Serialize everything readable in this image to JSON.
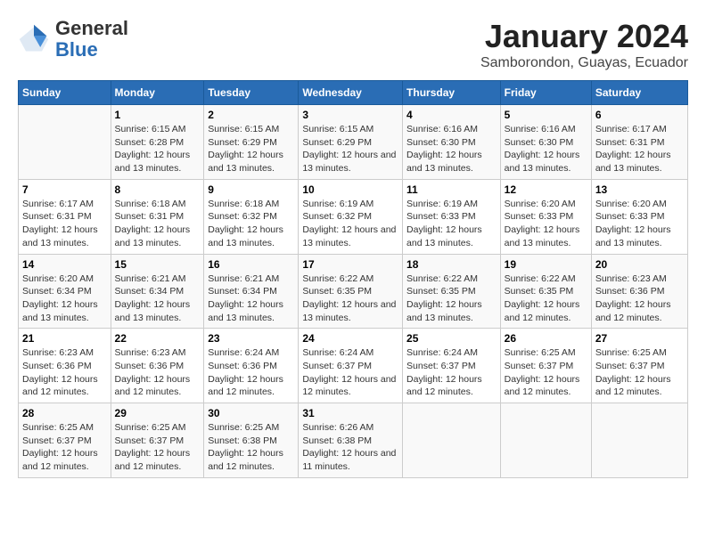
{
  "logo": {
    "general": "General",
    "blue": "Blue"
  },
  "title": "January 2024",
  "subtitle": "Samborondon, Guayas, Ecuador",
  "weekdays": [
    "Sunday",
    "Monday",
    "Tuesday",
    "Wednesday",
    "Thursday",
    "Friday",
    "Saturday"
  ],
  "weeks": [
    [
      {
        "day": "",
        "sunrise": "",
        "sunset": "",
        "daylight": ""
      },
      {
        "day": "1",
        "sunrise": "Sunrise: 6:15 AM",
        "sunset": "Sunset: 6:28 PM",
        "daylight": "Daylight: 12 hours and 13 minutes."
      },
      {
        "day": "2",
        "sunrise": "Sunrise: 6:15 AM",
        "sunset": "Sunset: 6:29 PM",
        "daylight": "Daylight: 12 hours and 13 minutes."
      },
      {
        "day": "3",
        "sunrise": "Sunrise: 6:15 AM",
        "sunset": "Sunset: 6:29 PM",
        "daylight": "Daylight: 12 hours and 13 minutes."
      },
      {
        "day": "4",
        "sunrise": "Sunrise: 6:16 AM",
        "sunset": "Sunset: 6:30 PM",
        "daylight": "Daylight: 12 hours and 13 minutes."
      },
      {
        "day": "5",
        "sunrise": "Sunrise: 6:16 AM",
        "sunset": "Sunset: 6:30 PM",
        "daylight": "Daylight: 12 hours and 13 minutes."
      },
      {
        "day": "6",
        "sunrise": "Sunrise: 6:17 AM",
        "sunset": "Sunset: 6:31 PM",
        "daylight": "Daylight: 12 hours and 13 minutes."
      }
    ],
    [
      {
        "day": "7",
        "sunrise": "Sunrise: 6:17 AM",
        "sunset": "Sunset: 6:31 PM",
        "daylight": "Daylight: 12 hours and 13 minutes."
      },
      {
        "day": "8",
        "sunrise": "Sunrise: 6:18 AM",
        "sunset": "Sunset: 6:31 PM",
        "daylight": "Daylight: 12 hours and 13 minutes."
      },
      {
        "day": "9",
        "sunrise": "Sunrise: 6:18 AM",
        "sunset": "Sunset: 6:32 PM",
        "daylight": "Daylight: 12 hours and 13 minutes."
      },
      {
        "day": "10",
        "sunrise": "Sunrise: 6:19 AM",
        "sunset": "Sunset: 6:32 PM",
        "daylight": "Daylight: 12 hours and 13 minutes."
      },
      {
        "day": "11",
        "sunrise": "Sunrise: 6:19 AM",
        "sunset": "Sunset: 6:33 PM",
        "daylight": "Daylight: 12 hours and 13 minutes."
      },
      {
        "day": "12",
        "sunrise": "Sunrise: 6:20 AM",
        "sunset": "Sunset: 6:33 PM",
        "daylight": "Daylight: 12 hours and 13 minutes."
      },
      {
        "day": "13",
        "sunrise": "Sunrise: 6:20 AM",
        "sunset": "Sunset: 6:33 PM",
        "daylight": "Daylight: 12 hours and 13 minutes."
      }
    ],
    [
      {
        "day": "14",
        "sunrise": "Sunrise: 6:20 AM",
        "sunset": "Sunset: 6:34 PM",
        "daylight": "Daylight: 12 hours and 13 minutes."
      },
      {
        "day": "15",
        "sunrise": "Sunrise: 6:21 AM",
        "sunset": "Sunset: 6:34 PM",
        "daylight": "Daylight: 12 hours and 13 minutes."
      },
      {
        "day": "16",
        "sunrise": "Sunrise: 6:21 AM",
        "sunset": "Sunset: 6:34 PM",
        "daylight": "Daylight: 12 hours and 13 minutes."
      },
      {
        "day": "17",
        "sunrise": "Sunrise: 6:22 AM",
        "sunset": "Sunset: 6:35 PM",
        "daylight": "Daylight: 12 hours and 13 minutes."
      },
      {
        "day": "18",
        "sunrise": "Sunrise: 6:22 AM",
        "sunset": "Sunset: 6:35 PM",
        "daylight": "Daylight: 12 hours and 13 minutes."
      },
      {
        "day": "19",
        "sunrise": "Sunrise: 6:22 AM",
        "sunset": "Sunset: 6:35 PM",
        "daylight": "Daylight: 12 hours and 12 minutes."
      },
      {
        "day": "20",
        "sunrise": "Sunrise: 6:23 AM",
        "sunset": "Sunset: 6:36 PM",
        "daylight": "Daylight: 12 hours and 12 minutes."
      }
    ],
    [
      {
        "day": "21",
        "sunrise": "Sunrise: 6:23 AM",
        "sunset": "Sunset: 6:36 PM",
        "daylight": "Daylight: 12 hours and 12 minutes."
      },
      {
        "day": "22",
        "sunrise": "Sunrise: 6:23 AM",
        "sunset": "Sunset: 6:36 PM",
        "daylight": "Daylight: 12 hours and 12 minutes."
      },
      {
        "day": "23",
        "sunrise": "Sunrise: 6:24 AM",
        "sunset": "Sunset: 6:36 PM",
        "daylight": "Daylight: 12 hours and 12 minutes."
      },
      {
        "day": "24",
        "sunrise": "Sunrise: 6:24 AM",
        "sunset": "Sunset: 6:37 PM",
        "daylight": "Daylight: 12 hours and 12 minutes."
      },
      {
        "day": "25",
        "sunrise": "Sunrise: 6:24 AM",
        "sunset": "Sunset: 6:37 PM",
        "daylight": "Daylight: 12 hours and 12 minutes."
      },
      {
        "day": "26",
        "sunrise": "Sunrise: 6:25 AM",
        "sunset": "Sunset: 6:37 PM",
        "daylight": "Daylight: 12 hours and 12 minutes."
      },
      {
        "day": "27",
        "sunrise": "Sunrise: 6:25 AM",
        "sunset": "Sunset: 6:37 PM",
        "daylight": "Daylight: 12 hours and 12 minutes."
      }
    ],
    [
      {
        "day": "28",
        "sunrise": "Sunrise: 6:25 AM",
        "sunset": "Sunset: 6:37 PM",
        "daylight": "Daylight: 12 hours and 12 minutes."
      },
      {
        "day": "29",
        "sunrise": "Sunrise: 6:25 AM",
        "sunset": "Sunset: 6:37 PM",
        "daylight": "Daylight: 12 hours and 12 minutes."
      },
      {
        "day": "30",
        "sunrise": "Sunrise: 6:25 AM",
        "sunset": "Sunset: 6:38 PM",
        "daylight": "Daylight: 12 hours and 12 minutes."
      },
      {
        "day": "31",
        "sunrise": "Sunrise: 6:26 AM",
        "sunset": "Sunset: 6:38 PM",
        "daylight": "Daylight: 12 hours and 11 minutes."
      },
      {
        "day": "",
        "sunrise": "",
        "sunset": "",
        "daylight": ""
      },
      {
        "day": "",
        "sunrise": "",
        "sunset": "",
        "daylight": ""
      },
      {
        "day": "",
        "sunrise": "",
        "sunset": "",
        "daylight": ""
      }
    ]
  ]
}
